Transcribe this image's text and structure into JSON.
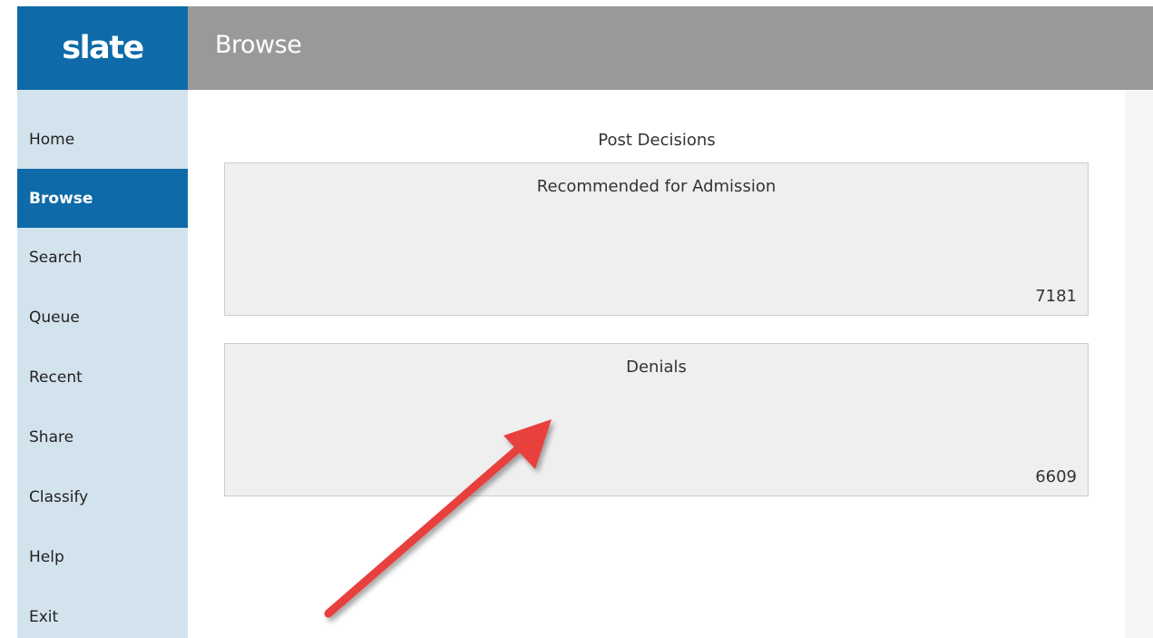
{
  "brand": {
    "logo_text": "slate",
    "color": "#0e6aa8"
  },
  "header": {
    "title": "Browse",
    "background": "#999999"
  },
  "sidebar": {
    "background": "#d3e3ee",
    "items": [
      {
        "label": "Home",
        "active": false
      },
      {
        "label": "Browse",
        "active": true
      },
      {
        "label": "Search",
        "active": false
      },
      {
        "label": "Queue",
        "active": false
      },
      {
        "label": "Recent",
        "active": false
      },
      {
        "label": "Share",
        "active": false
      },
      {
        "label": "Classify",
        "active": false
      },
      {
        "label": "Help",
        "active": false
      },
      {
        "label": "Exit",
        "active": false
      }
    ]
  },
  "main": {
    "section_title": "Post Decisions",
    "tiles": [
      {
        "label": "Recommended for Admission",
        "count": "7181"
      },
      {
        "label": "Denials",
        "count": "6609"
      }
    ]
  },
  "annotation": {
    "icon": "red-arrow-icon",
    "color": "#e8413d"
  }
}
